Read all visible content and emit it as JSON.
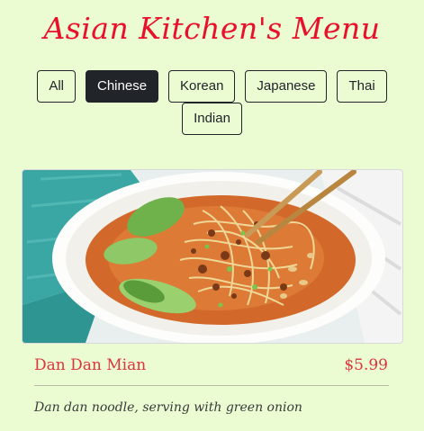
{
  "page": {
    "title": "Asian Kitchen's Menu"
  },
  "filters": [
    {
      "label": "All",
      "active": false
    },
    {
      "label": "Chinese",
      "active": true
    },
    {
      "label": "Korean",
      "active": false
    },
    {
      "label": "Japanese",
      "active": false
    },
    {
      "label": "Thai",
      "active": false
    },
    {
      "label": "Indian",
      "active": false
    }
  ],
  "menu_item": {
    "name": "Dan Dan Mian",
    "price": "$5.99",
    "description": "Dan dan noodle, serving with green onion",
    "image_icon": "noodle-bowl-photo"
  },
  "colors": {
    "background": "#ebfbd2",
    "title": "#e8102b",
    "item_text": "#d9363e",
    "button_dark": "#212529"
  }
}
